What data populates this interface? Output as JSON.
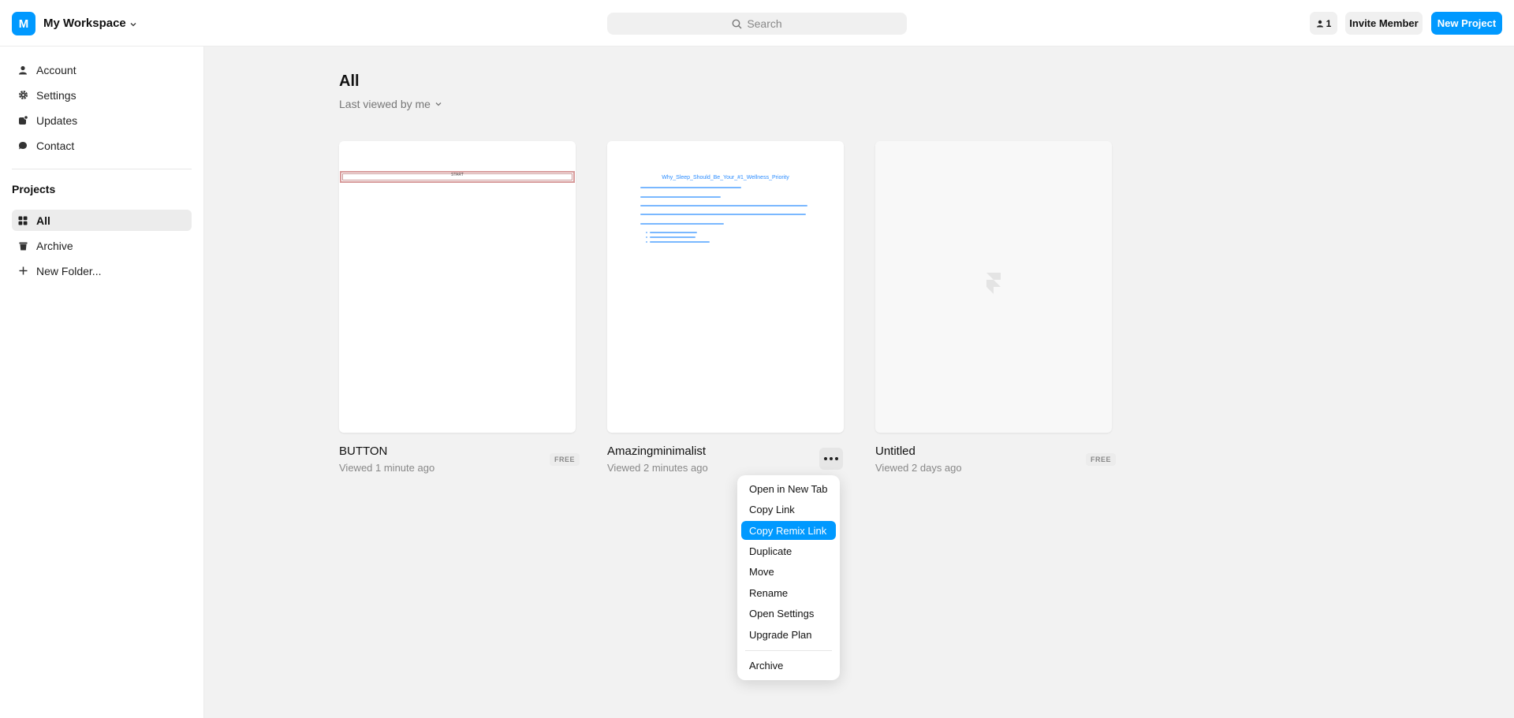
{
  "workspace": {
    "initial": "M",
    "name": "My Workspace"
  },
  "search": {
    "placeholder": "Search"
  },
  "header": {
    "member_count": "1",
    "invite_label": "Invite Member",
    "new_project_label": "New Project"
  },
  "sidebar": {
    "items": [
      {
        "label": "Account",
        "icon": "user-icon"
      },
      {
        "label": "Settings",
        "icon": "gear-icon"
      },
      {
        "label": "Updates",
        "icon": "updates-icon"
      },
      {
        "label": "Contact",
        "icon": "chat-icon"
      }
    ],
    "projects_title": "Projects",
    "project_items": [
      {
        "label": "All",
        "icon": "grid-icon",
        "active": true
      },
      {
        "label": "Archive",
        "icon": "trash-icon"
      },
      {
        "label": "New Folder...",
        "icon": "plus-icon"
      }
    ]
  },
  "main": {
    "title": "All",
    "sort_label": "Last viewed by me"
  },
  "projects": [
    {
      "name": "BUTTON",
      "viewed": "Viewed 1 minute ago",
      "badge": "FREE",
      "thumb_text": "START"
    },
    {
      "name": "Amazingminimalist",
      "viewed": "Viewed 2 minutes ago",
      "thumb_title": "Why_Sleep_Should_Be_Your_#1_Wellness_Priority"
    },
    {
      "name": "Untitled",
      "viewed": "Viewed 2 days ago",
      "badge": "FREE"
    }
  ],
  "context_menu": {
    "items": [
      "Open in New Tab",
      "Copy Link",
      "Copy Remix Link",
      "Duplicate",
      "Move",
      "Rename",
      "Open Settings",
      "Upgrade Plan",
      "Archive"
    ],
    "highlighted": "Copy Remix Link"
  },
  "colors": {
    "accent": "#0099ff",
    "background": "#f2f2f2"
  }
}
